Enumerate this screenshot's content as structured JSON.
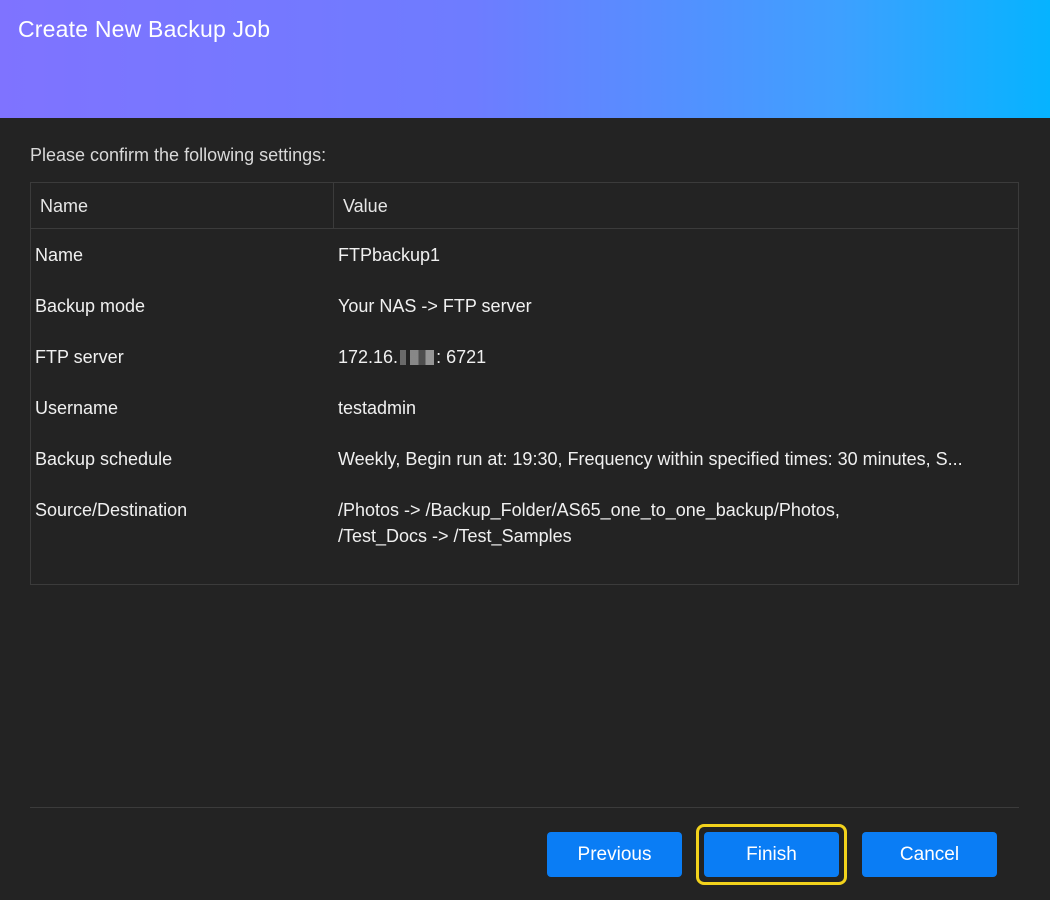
{
  "dialog": {
    "title": "Create New Backup Job",
    "prompt": "Please confirm the following settings:",
    "table": {
      "headers": {
        "name": "Name",
        "value": "Value"
      },
      "rows": [
        {
          "name": "Name",
          "value": "FTPbackup1"
        },
        {
          "name": "Backup mode",
          "value": "Your NAS -> FTP server"
        },
        {
          "name": "FTP server",
          "value_prefix": "172.16.",
          "value_suffix": ": 6721"
        },
        {
          "name": "Username",
          "value": "testadmin"
        },
        {
          "name": "Backup schedule",
          "value": "Weekly, Begin run at: 19:30, Frequency within specified times: 30 minutes, S..."
        },
        {
          "name": "Source/Destination",
          "value_line1": "/Photos -> /Backup_Folder/AS65_one_to_one_backup/Photos,",
          "value_line2": "/Test_Docs -> /Test_Samples"
        }
      ]
    },
    "buttons": {
      "previous": "Previous",
      "finish": "Finish",
      "cancel": "Cancel"
    },
    "colors": {
      "accent": "#0a7df5",
      "highlight": "#f2d21c",
      "background": "#232323",
      "header_gradient_start": "#7f73ff",
      "header_gradient_end": "#06b3ff"
    }
  }
}
